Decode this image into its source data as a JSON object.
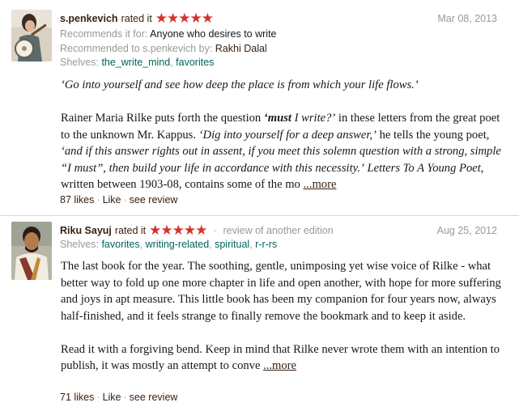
{
  "reviews": [
    {
      "user": "s.penkevich",
      "rated_text": "rated it",
      "stars": "★★★★★",
      "date": "Mar 08, 2013",
      "recommends_label": "Recommends it for:",
      "recommends_value": "Anyone who desires to write",
      "recommended_to_label": "Recommended to s.penkevich by:",
      "recommended_to_value": "Rakhi Dalal",
      "shelves_label": "Shelves:",
      "shelves": [
        "the_write_mind",
        "favorites"
      ],
      "quote": "‘Go into yourself and see how deep the place is from which your life flows.’",
      "body_part1": "Rainer Maria Rilke puts forth the question ",
      "body_strong": "‘must",
      "body_italic1": " I write?’",
      "body_part2": " in these letters from the great poet to the unknown Mr. Kappus. ",
      "body_italic2": "‘Dig into yourself for a deep answer,’",
      "body_part3": " he tells the young poet, ",
      "body_italic3": "‘and if this answer rights out in assent, if you meet this solemn question with a strong, simple “I must”, then build your life in accordance with this necessity.’",
      "body_italic4": "Letters To A Young Poet",
      "body_part4": ", written between 1903-08, contains some of the mo ",
      "more": "...more",
      "likes": "87 likes",
      "like": "Like",
      "see_review": "see review"
    },
    {
      "user": "Riku Sayuj",
      "rated_text": "rated it",
      "stars": "★★★★★",
      "review_of_other": "review of another edition",
      "date": "Aug 25, 2012",
      "shelves_label": "Shelves:",
      "shelves": [
        "favorites",
        "writing-related",
        "spiritual",
        "r-r-rs"
      ],
      "para1": "The last book for the year. The soothing, gentle, unimposing yet wise voice of Rilke - what better way to fold up one more chapter in life and open another, with hope for more suffering and joys in apt measure. This little book has been my companion for four years now, always half-finished, and it feels strange to finally remove the bookmark and to keep it aside.",
      "para2": "Read it with a forgiving bend. Keep in mind that Rilke never wrote them with an intention to publish, it was mostly an attempt to conve ",
      "more": "...more",
      "likes": "71 likes",
      "like": "Like",
      "see_review": "see review"
    }
  ],
  "colors": {
    "star": "#d6322a",
    "link_dark": "#382110",
    "link_green": "#00635d",
    "muted": "#999999"
  }
}
